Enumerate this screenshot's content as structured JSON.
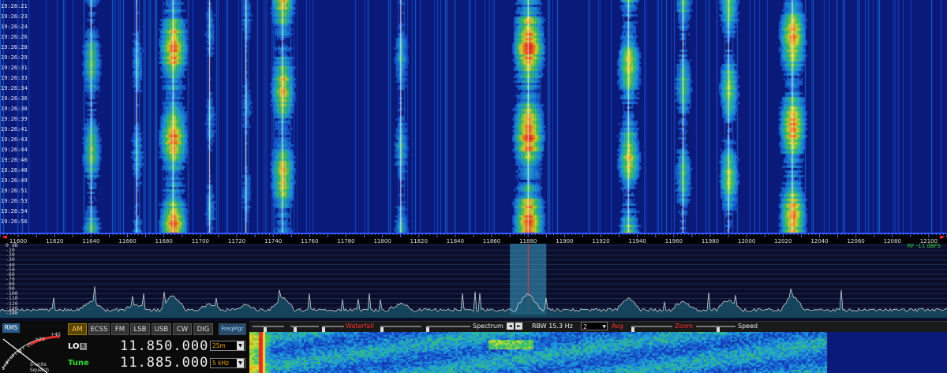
{
  "waterfall": {
    "timestamps": [
      "19:26:21",
      "19:26:23",
      "19:26:24",
      "19:26:26",
      "19:26:28",
      "19:26:29",
      "19:26:31",
      "19:26:33",
      "19:26:34",
      "19:26:36",
      "19:26:38",
      "19:26:39",
      "19:26:41",
      "19:26:43",
      "19:26:44",
      "19:26:46",
      "19:26:48",
      "19:26:49",
      "19:26:51",
      "19:26:53",
      "19:26:54",
      "19:26:56"
    ],
    "stations": [
      {
        "freq": 11640,
        "strength": 0.55
      },
      {
        "freq": 11665,
        "strength": 0.35
      },
      {
        "freq": 11685,
        "strength": 0.9
      },
      {
        "freq": 11745,
        "strength": 0.75
      },
      {
        "freq": 11810,
        "strength": 0.4
      },
      {
        "freq": 11880,
        "strength": 1.0
      },
      {
        "freq": 11935,
        "strength": 0.7
      },
      {
        "freq": 11965,
        "strength": 0.5
      },
      {
        "freq": 11990,
        "strength": 0.6
      },
      {
        "freq": 12025,
        "strength": 0.85
      },
      {
        "freq": 11705,
        "strength": 0.3
      },
      {
        "freq": 11725,
        "strength": 0.3
      }
    ]
  },
  "scale": {
    "start": 11590,
    "end": 12110,
    "labels": [
      "11600",
      "11620",
      "11640",
      "11660",
      "11680",
      "11700",
      "11720",
      "11740",
      "11760",
      "11780",
      "11800",
      "11820",
      "11840",
      "11860",
      "11880",
      "11900",
      "11920",
      "11940",
      "11960",
      "11980",
      "12000",
      "12020",
      "12040",
      "12060",
      "12080",
      "12100"
    ],
    "left_arrow": "◄",
    "right_arrow": "►"
  },
  "spectrum": {
    "db_labels": [
      "0 dB",
      "-10",
      "-20",
      "-30",
      "-40",
      "-50",
      "-60",
      "-70",
      "-80",
      "-90",
      "-100",
      "-110",
      "-120",
      "-130",
      "-140"
    ],
    "rf_readout": "RF -11 dBFS",
    "tuned_freq": 11880,
    "filter_width_khz": 10
  },
  "controls": {
    "waterfall_label": "Waterfall",
    "spectrum_label": "Spectrum",
    "rbw_label": "RBW 15.3 Hz",
    "avg_value": "2",
    "avg_label": "Avg",
    "zoom_label": "Zoom",
    "speed_label": "Speed"
  },
  "panel": {
    "rms_label": "RMS",
    "smeter_scale": [
      "+20",
      "+40",
      "3",
      "5",
      "7",
      "9",
      "1"
    ],
    "smeter_caption_1": "S-units",
    "smeter_caption_2": "Squelch",
    "modes": [
      "AM",
      "ECSS",
      "FM",
      "LSB",
      "USB",
      "CW",
      "DIG"
    ],
    "active_mode": "AM",
    "freqmgr_label": "FreqMgr",
    "lo_label": "LO",
    "lo_badge": "B",
    "lo_freq": "11.850.000",
    "lo_band": "25m",
    "tune_label": "Tune",
    "tune_freq": "11.885.000",
    "tune_step": "5 kHz"
  },
  "colors": {
    "background": "#000000",
    "waterfall_base": "#0a1a7a",
    "accent_red": "#ff3030",
    "accent_green": "#33dd33",
    "active_mode_bg": "#5a4400"
  }
}
